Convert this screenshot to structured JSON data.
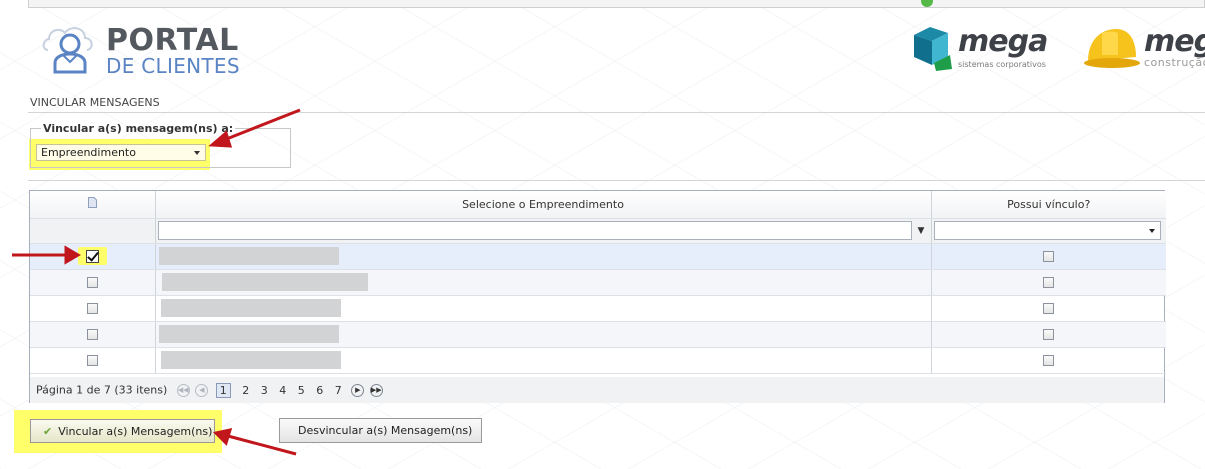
{
  "header": {
    "portal_title": "PORTAL",
    "portal_subtitle": "DE CLIENTES",
    "mega_name": "mega",
    "mega_tagline": "sistemas corporativos",
    "mega2_name": "mega",
    "mega2_tagline": "construção"
  },
  "section": {
    "title": "VINCULAR MENSAGENS"
  },
  "form": {
    "legend": "Vincular a(s) mensagem(ns) a:",
    "selected": "Empreendimento"
  },
  "grid": {
    "col_select": "Selecione o Empreendimento",
    "col_vinculo": "Possui vínculo?",
    "rows": [
      {
        "checked": true,
        "vinculo": false
      },
      {
        "checked": false,
        "vinculo": false
      },
      {
        "checked": false,
        "vinculo": false
      },
      {
        "checked": false,
        "vinculo": false
      },
      {
        "checked": false,
        "vinculo": false
      }
    ]
  },
  "pager": {
    "info": "Página 1 de 7 (33 itens)",
    "pages": [
      "1",
      "2",
      "3",
      "4",
      "5",
      "6",
      "7"
    ],
    "current": "1"
  },
  "actions": {
    "vincular": "Vincular a(s) Mensagem(ns)",
    "desvincular": "Desvincular a(s) Mensagem(ns)"
  },
  "colors": {
    "highlight": "#ffff6a",
    "arrow": "#c0161c",
    "portal_blue": "#5b84c4",
    "mega_teal": "#1c8aa6"
  }
}
